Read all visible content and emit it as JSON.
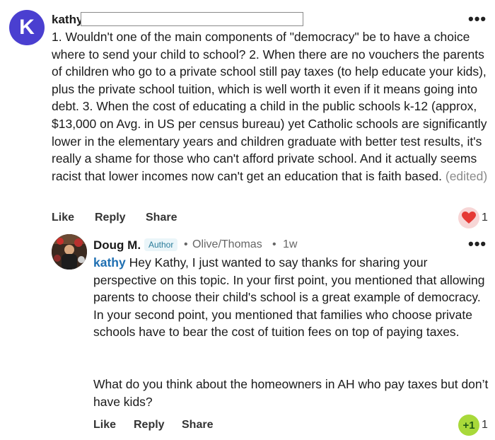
{
  "comment": {
    "avatar_letter": "K",
    "author": "kathy",
    "text": "1. Wouldn't one of the main components of \"democracy\" be to have a choice where to send your child to school?  2. When there are no vouchers the parents of children who go to a private school still pay taxes (to help educate your kids), plus the private school tuition, which is well worth it even if it means going into debt.  3.  When the cost of educating a child in the public schools k-12 (approx, $13,000 on Avg. in US per census bureau) yet Catholic schools are significantly lower in the elementary years and children graduate with better test results, it's really a shame for those who can't afford private school.  And it actually seems racist that lower incomes now can't get an education that is faith based.",
    "edited_label": "(edited)",
    "actions": {
      "like": "Like",
      "reply": "Reply",
      "share": "Share"
    },
    "reaction_count": "1",
    "more_icon": "more-horizontal-icon"
  },
  "reply": {
    "author": "Doug M.",
    "badge": "Author",
    "location": "Olive/Thomas",
    "separator": "•",
    "time": "1w",
    "mention": "kathy",
    "text_p1": "Hey Kathy, I just wanted to say thanks for sharing your perspective on this topic. In your first point, you mentioned that allowing parents to choose their child's school is a great example of democracy. In your second point, you mentioned that families who choose private schools have to bear the cost of tuition fees on top of paying taxes.",
    "text_p2": "What do you think about the homeowners in AH who pay taxes but don’t have kids?",
    "actions": {
      "like": "Like",
      "reply": "Reply",
      "share": "Share"
    },
    "reaction_label": "+1",
    "reaction_count": "1"
  },
  "colors": {
    "avatar": "#4a3fd0",
    "mention": "#1f6fb2",
    "heart": "#e53935",
    "plus_one": "#a8d93a"
  }
}
